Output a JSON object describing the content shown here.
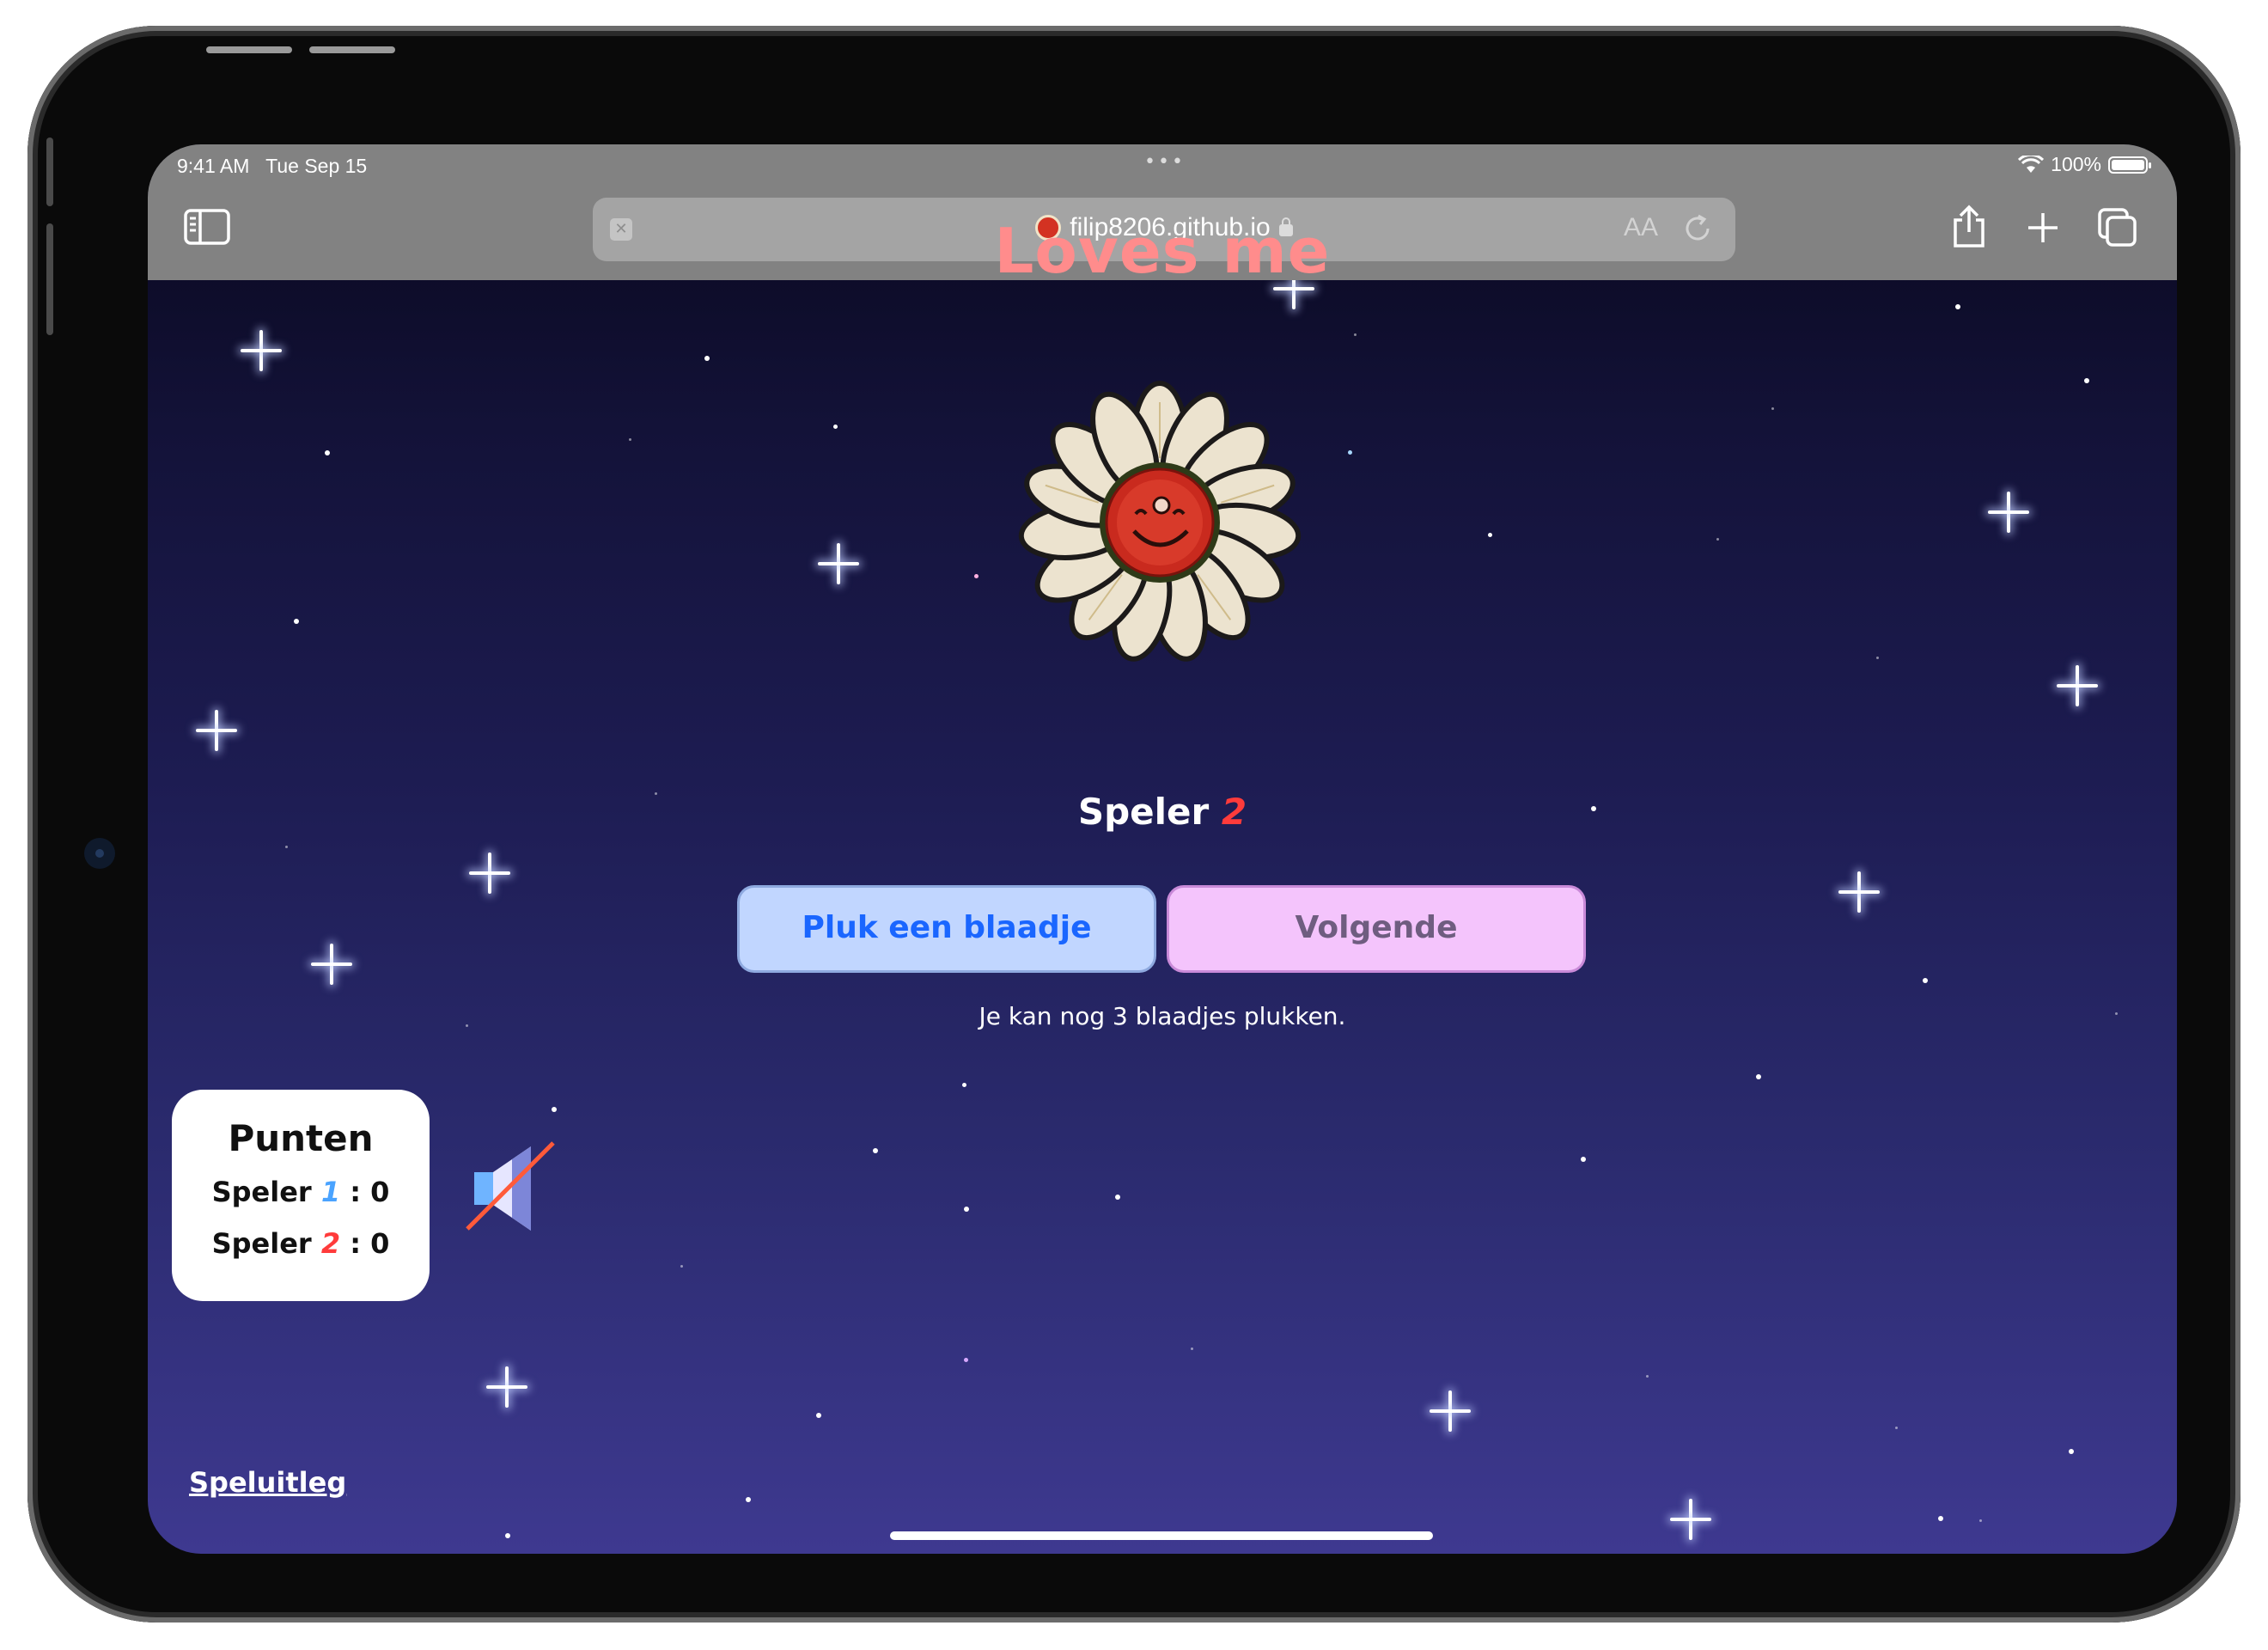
{
  "status_bar": {
    "time": "9:41 AM",
    "date": "Tue Sep 15",
    "battery": "100%"
  },
  "browser": {
    "url": "filip8206.github.io",
    "text_size_label": "AA"
  },
  "game": {
    "title": "Loves me",
    "player_label": "Speler",
    "current_player": "2",
    "pick_button": "Pluk een blaadje",
    "next_button": "Volgende",
    "hint": "Je kan nog 3 blaadjes plukken."
  },
  "scores": {
    "title": "Punten",
    "player_label": "Speler",
    "p1": {
      "number": "1",
      "separator": ":",
      "score": "0"
    },
    "p2": {
      "number": "2",
      "separator": ":",
      "score": "0"
    }
  },
  "footer": {
    "help_link": "Speluitleg"
  },
  "colors": {
    "title": "#ff8c8c",
    "player1": "#4aa3ff",
    "player2": "#ff3b3b",
    "pick_button_bg": "#c1d6ff",
    "next_button_bg": "#f4c4fc"
  },
  "icons": [
    "sidebar-icon",
    "favicon-icon",
    "lock-icon",
    "reload-icon",
    "share-icon",
    "plus-icon",
    "tabs-icon",
    "flower-icon",
    "muted-speaker-icon",
    "battery-icon",
    "wifi-icon"
  ]
}
